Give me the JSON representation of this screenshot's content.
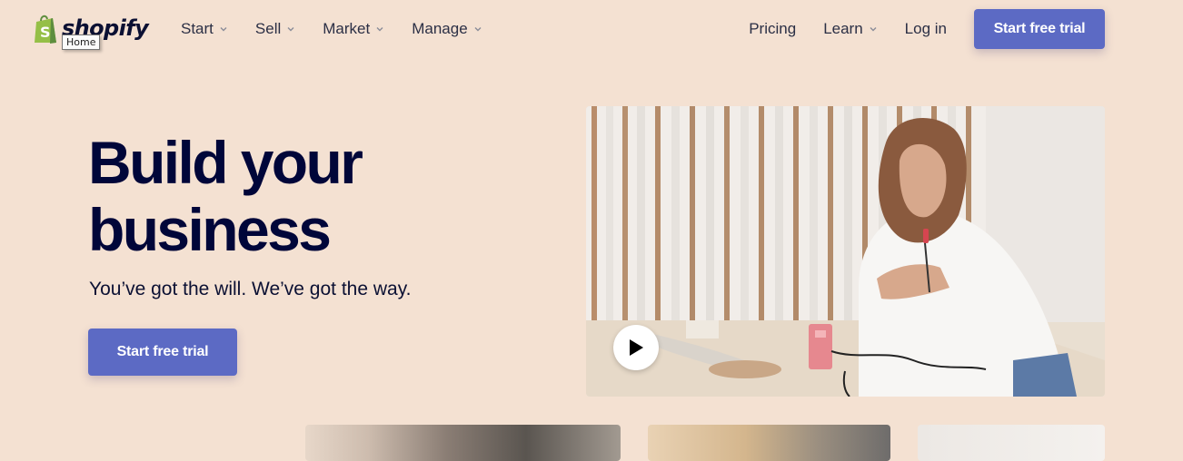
{
  "header": {
    "logo_text": "shopify",
    "tooltip": "Home",
    "nav_left": [
      {
        "label": "Start",
        "icon": "chevron-down-icon"
      },
      {
        "label": "Sell",
        "icon": "chevron-down-icon"
      },
      {
        "label": "Market",
        "icon": "chevron-down-icon"
      },
      {
        "label": "Manage",
        "icon": "chevron-down-icon"
      }
    ],
    "nav_right": {
      "pricing": "Pricing",
      "learn": "Learn",
      "login": "Log in",
      "cta": "Start free trial"
    }
  },
  "hero": {
    "title_line1": "Build your",
    "title_line2": "business",
    "subtitle": "You’ve got the will. We’ve got the way.",
    "cta": "Start free trial"
  },
  "media": {
    "video_alt": "Woman working with a soldering tool at a workbench",
    "play_icon": "play-icon"
  },
  "colors": {
    "background": "#f4e1d2",
    "primary_button": "#5c6ac4",
    "heading": "#000639",
    "logo_green": "#95bf47"
  }
}
